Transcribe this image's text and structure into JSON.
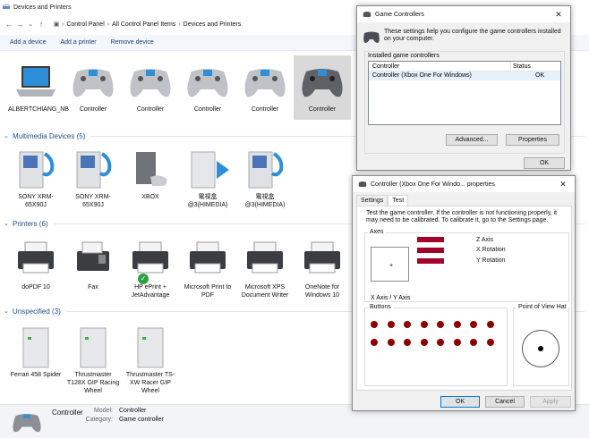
{
  "window": {
    "title": "Devices and Printers",
    "breadcrumbs": [
      "Control Panel",
      "All Control Panel Items",
      "Devices and Printers"
    ],
    "toolbar": [
      "Add a device",
      "Add a printer",
      "Remove device"
    ]
  },
  "groups": {
    "devices": {
      "items": [
        "ALBERTCHIANG_NB",
        "Controller",
        "Controller",
        "Controller",
        "Controller",
        "Controller"
      ]
    },
    "multimedia": {
      "title": "Multimedia Devices (5)",
      "items": [
        "SONY XRM-65X90J",
        "SONY XRM-65X90J",
        "XBOX",
        "電視盒 @3(HIMEDIA)",
        "電視盒 @3(HIMEDIA)"
      ]
    },
    "printers": {
      "title": "Printers (6)",
      "items": [
        "doPDF 10",
        "Fax",
        "HP ePrint + JetAdvantage",
        "Microsoft Print to PDF",
        "Microsoft XPS Document Writer",
        "OneNote for Windows 10"
      ]
    },
    "unspecified": {
      "title": "Unspecified (3)",
      "items": [
        "Ferrari 458 Spider",
        "Thrustmaster T128X GIP Racing Wheel",
        "Thrustmaster TS-XW Racer GIP Wheel"
      ]
    }
  },
  "details": {
    "name": "Controller",
    "model_key": "Model:",
    "model_val": "Controller",
    "category_key": "Category:",
    "category_val": "Game controller"
  },
  "game_controllers": {
    "title": "Game Controllers",
    "description": "These settings help you configure the game controllers installed on your computer.",
    "list_label": "Installed game controllers",
    "col_controller": "Controller",
    "col_status": "Status",
    "row_controller": "Controller (Xbox One For Windows)",
    "row_status": "OK",
    "advanced": "Advanced...",
    "properties": "Properties",
    "ok": "OK"
  },
  "properties_dialog": {
    "title": "Controller (Xbox One For Windo... properties",
    "tabs": [
      "Settings",
      "Test"
    ],
    "description": "Test the game controller.  If the controller is not functioning properly, it may need to be calibrated.  To calibrate it, go to the Settings page.",
    "axes_label": "Axes",
    "axis_z": "Z Axis",
    "axis_xrot": "X Rotation",
    "axis_yrot": "Y Rotation",
    "xy_label": "X Axis / Y Axis",
    "buttons_label": "Buttons",
    "pov_label": "Point of View Hat",
    "button_count": 16,
    "ok": "OK",
    "cancel": "Cancel",
    "apply": "Apply"
  },
  "colors": {
    "axis_bar": "#a0002a",
    "button_dot": "#8b0000",
    "group_header": "#1e4e8c",
    "selection": "#cce4f7"
  }
}
